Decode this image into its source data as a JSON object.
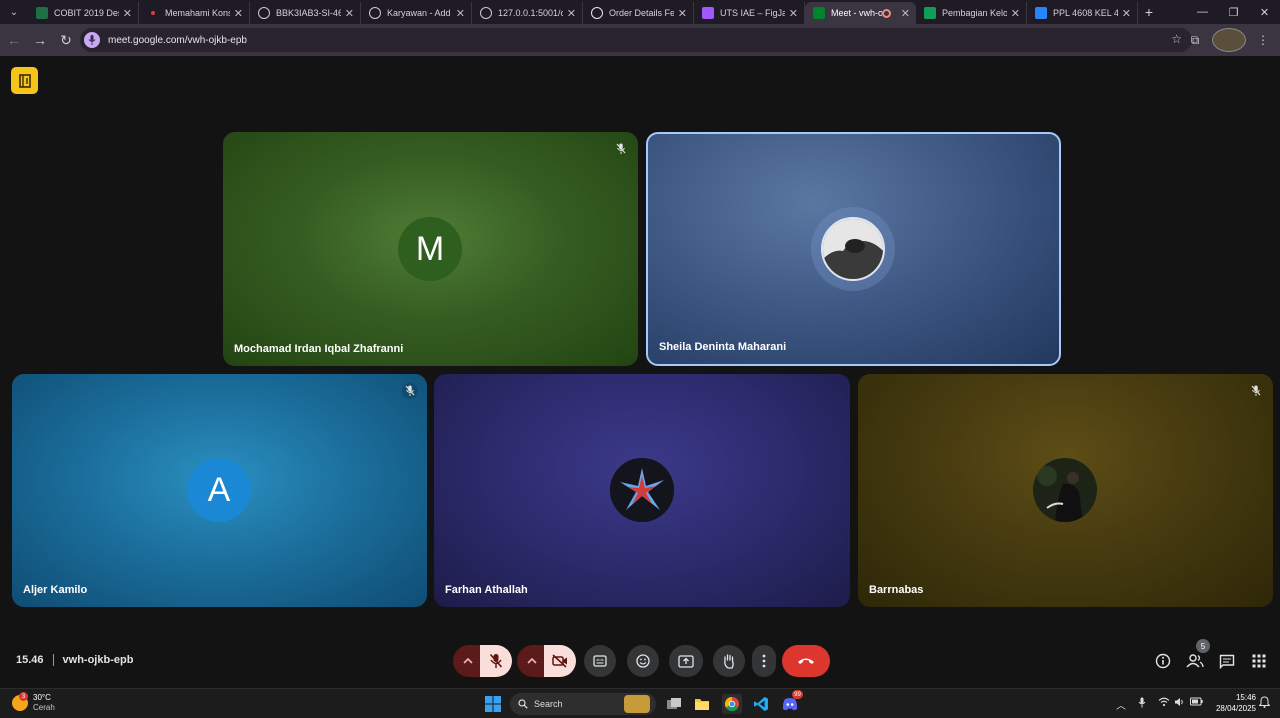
{
  "browser": {
    "tabs": [
      {
        "title": "COBIT 2019 Desig",
        "favicon": "excel-icon",
        "color": "#1d7044"
      },
      {
        "title": "Memahami Konse",
        "favicon": "red-dot-icon",
        "color": "#e03a3a"
      },
      {
        "title": "BBK3IAB3-SI-46-0",
        "favicon": "globe-icon",
        "color": "#5f6368"
      },
      {
        "title": "Karyawan - Add C",
        "favicon": "globe-icon",
        "color": "#5f6368"
      },
      {
        "title": "127.0.0.1:5001/o",
        "favicon": "globe-icon",
        "color": "#5f6368"
      },
      {
        "title": "Order Details Fet",
        "favicon": "openai-icon",
        "color": "#2a2a2a"
      },
      {
        "title": "UTS IAE – FigJam",
        "favicon": "figma-icon",
        "color": "#a259ff"
      },
      {
        "title": "Meet - vwh-o",
        "favicon": "meet-icon",
        "color": "#00832d",
        "active": true
      },
      {
        "title": "Pembagian Kelom",
        "favicon": "sheets-icon",
        "color": "#0f9d58"
      },
      {
        "title": "PPL 4608 KEL 4 -",
        "favicon": "jira-icon",
        "color": "#2684ff"
      }
    ],
    "url": "meet.google.com/vwh-ojkb-epb"
  },
  "participants": [
    {
      "name": "Mochamad Irdan Iqbal Zhafranni",
      "initial": "M",
      "avatar_color": "#2f5f1f",
      "muted": true
    },
    {
      "name": "Sheila Deninta Maharani",
      "muted": false,
      "speaking": true
    },
    {
      "name": "Aljer Kamilo",
      "initial": "A",
      "avatar_color": "#1a88d4",
      "muted": true
    },
    {
      "name": "Farhan Athallah",
      "muted": false
    },
    {
      "name": "Barrnabas",
      "muted": true
    }
  ],
  "call": {
    "time": "15.46",
    "code": "vwh-ojkb-epb",
    "people_count": "5"
  },
  "taskbar": {
    "temperature": "30°C",
    "condition": "Cerah",
    "weather_alert": "3",
    "search_label": "Search",
    "clock_time": "15:46",
    "clock_date": "28/04/2025",
    "discord_badge": "99"
  }
}
